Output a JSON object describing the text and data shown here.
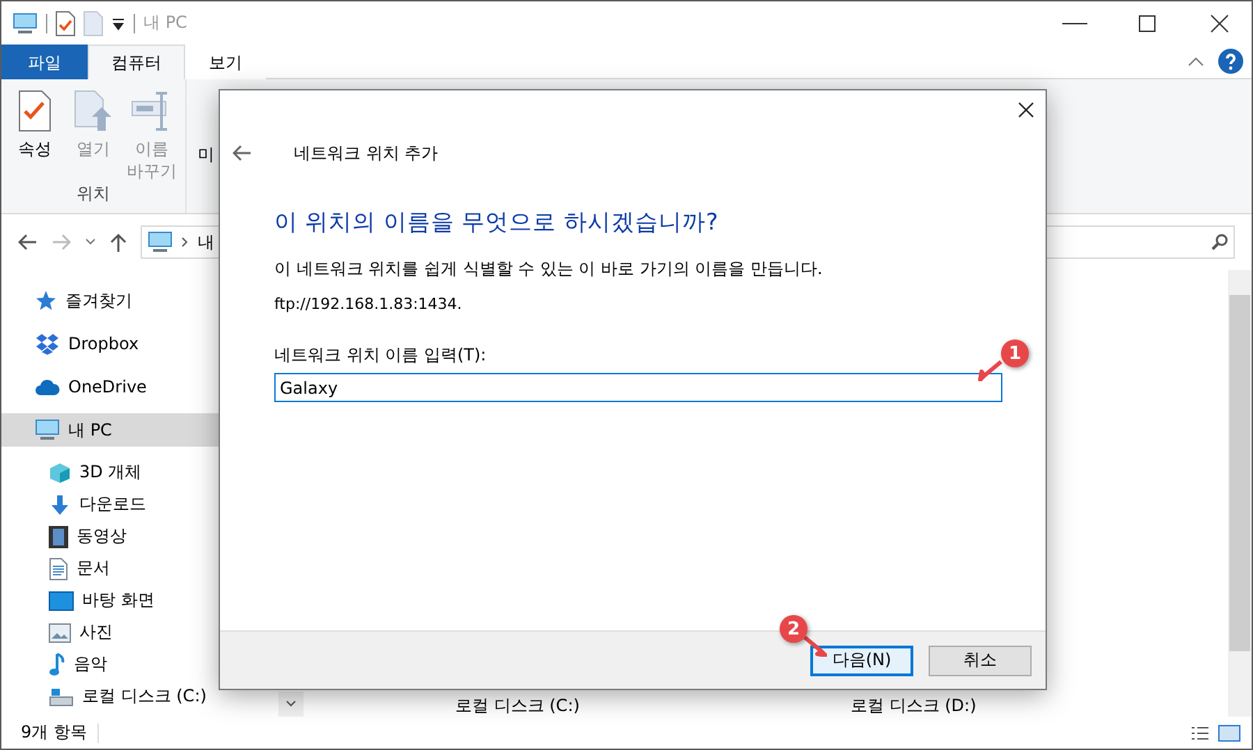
{
  "window": {
    "title": "내 PC"
  },
  "ribbon_tabs": [
    {
      "label": "파일",
      "kind": "file",
      "selected": false
    },
    {
      "label": "컴퓨터",
      "kind": "tab",
      "selected": true
    },
    {
      "label": "보기",
      "kind": "tab",
      "selected": false
    }
  ],
  "ribbon": {
    "groups": [
      {
        "label": "위치",
        "buttons": [
          {
            "label": "속성",
            "kind": "properties",
            "disabled": false
          },
          {
            "label": "열기",
            "kind": "open",
            "disabled": true
          },
          {
            "label": "이름 바꾸기",
            "kind": "rename",
            "disabled": true
          }
        ]
      }
    ],
    "cut_button": "미"
  },
  "address_bar": {
    "segment": "내"
  },
  "sidebar": {
    "items": [
      {
        "label": "즐겨찾기",
        "kind": "star",
        "selected": false
      },
      {
        "label": "Dropbox",
        "kind": "dropbox",
        "selected": false
      },
      {
        "label": "OneDrive",
        "kind": "cloud",
        "selected": false
      },
      {
        "label": "내 PC",
        "kind": "pc",
        "selected": true,
        "children": [
          {
            "label": "3D 개체",
            "kind": "cube",
            "selected": false
          },
          {
            "label": "다운로드",
            "kind": "download",
            "selected": false
          },
          {
            "label": "동영상",
            "kind": "film",
            "selected": false
          },
          {
            "label": "문서",
            "kind": "doc",
            "selected": false
          },
          {
            "label": "바탕 화면",
            "kind": "desktop",
            "selected": false
          },
          {
            "label": "사진",
            "kind": "photo",
            "selected": false
          },
          {
            "label": "음악",
            "kind": "music",
            "selected": false
          },
          {
            "label": "로컬 디스크 (C:)",
            "kind": "drive",
            "selected": false
          }
        ]
      }
    ]
  },
  "content": {
    "items": [
      {
        "label": "로컬 디스크 (C:)"
      },
      {
        "label": "로컬 디스크 (D:)"
      }
    ]
  },
  "status_bar": {
    "item_count": "9개 항목"
  },
  "dialog": {
    "title": "네트워크 위치 추가",
    "heading": "이 위치의 이름을 무엇으로 하시겠습니까?",
    "description": "이 네트워크 위치를 쉽게 식별할 수 있는 이 바로 가기의 이름을 만듭니다.",
    "address": "ftp://192.168.1.83:1434.",
    "field_label": "네트워크 위치 이름 입력(T):",
    "field_value": "Galaxy",
    "buttons": [
      {
        "label": "다음(N)",
        "focused": true
      },
      {
        "label": "취소",
        "focused": false
      }
    ]
  },
  "callouts": [
    {
      "number": "1"
    },
    {
      "number": "2"
    }
  ]
}
